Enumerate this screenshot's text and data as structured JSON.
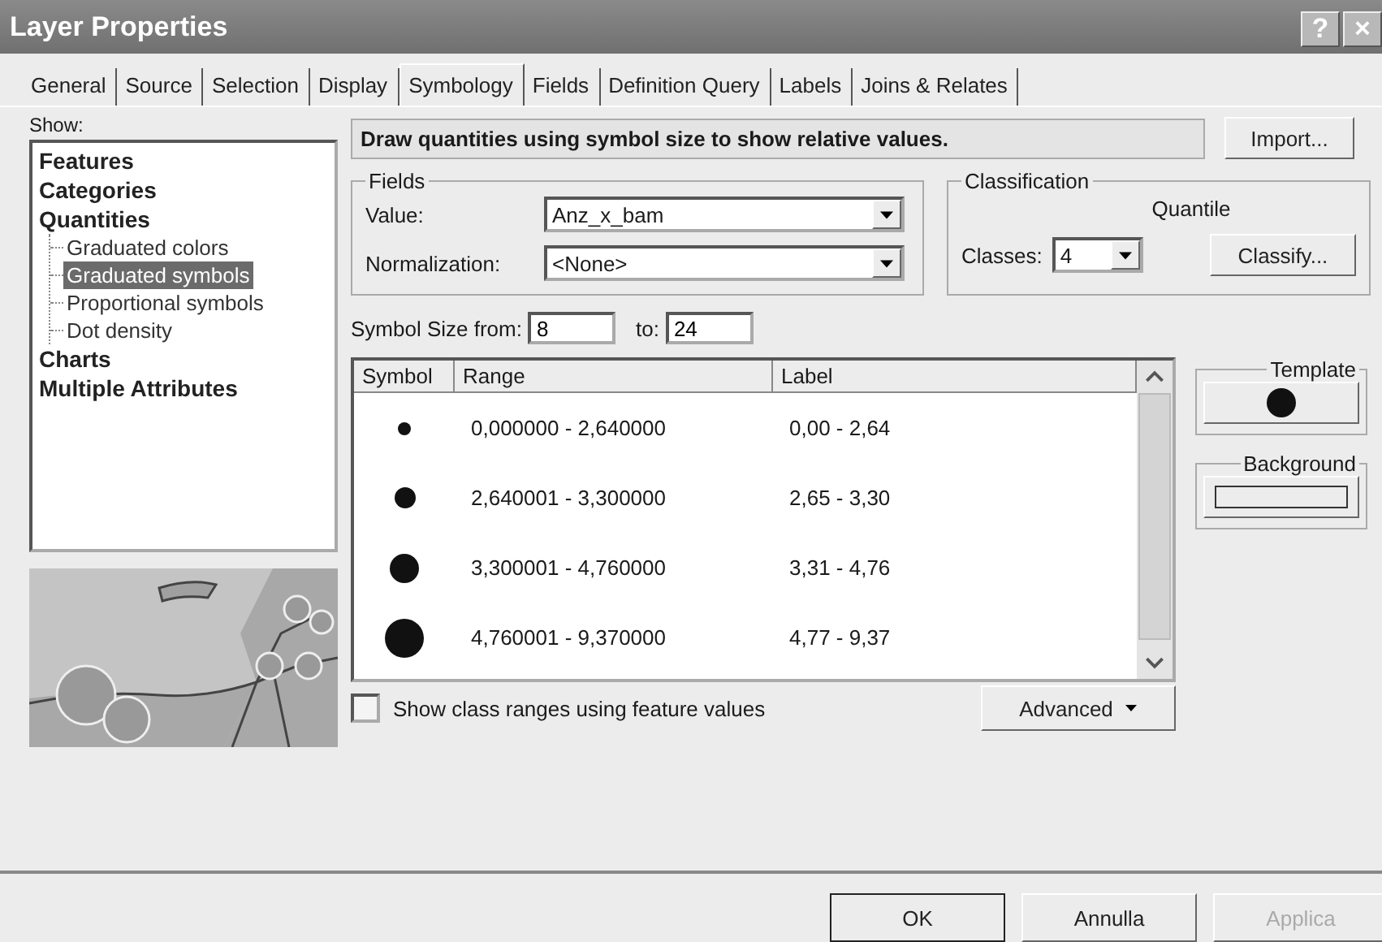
{
  "window": {
    "title": "Layer Properties",
    "help_glyph": "?",
    "close_glyph": "×"
  },
  "tabs": [
    {
      "label": "General",
      "selected": false
    },
    {
      "label": "Source",
      "selected": false
    },
    {
      "label": "Selection",
      "selected": false
    },
    {
      "label": "Display",
      "selected": false
    },
    {
      "label": "Symbology",
      "selected": true
    },
    {
      "label": "Fields",
      "selected": false
    },
    {
      "label": "Definition Query",
      "selected": false
    },
    {
      "label": "Labels",
      "selected": false
    },
    {
      "label": "Joins & Relates",
      "selected": false
    }
  ],
  "show": {
    "label": "Show:",
    "items": [
      {
        "label": "Features",
        "selected": false
      },
      {
        "label": "Categories",
        "selected": false
      },
      {
        "label": "Quantities",
        "selected": false,
        "children": [
          {
            "label": "Graduated colors",
            "selected": false
          },
          {
            "label": "Graduated symbols",
            "selected": true
          },
          {
            "label": "Proportional symbols",
            "selected": false
          },
          {
            "label": "Dot density",
            "selected": false
          }
        ]
      },
      {
        "label": "Charts",
        "selected": false
      },
      {
        "label": "Multiple Attributes",
        "selected": false
      }
    ]
  },
  "description": "Draw quantities using symbol size to show relative values.",
  "import_button": "Import...",
  "fields": {
    "title": "Fields",
    "value_label": "Value:",
    "value": "Anz_x_bam",
    "normalization_label": "Normalization:",
    "normalization": "<None>"
  },
  "classification": {
    "title": "Classification",
    "method": "Quantile",
    "classes_label": "Classes:",
    "classes": "4",
    "classify_button": "Classify..."
  },
  "symbol_size": {
    "from_label": "Symbol Size from:",
    "from": "8",
    "to_label": "to:",
    "to": "24"
  },
  "table": {
    "columns": [
      "Symbol",
      "Range",
      "Label"
    ],
    "rows": [
      {
        "range": "0,000000 - 2,640000",
        "label": "0,00 - 2,64"
      },
      {
        "range": "2,640001 - 3,300000",
        "label": "2,65 - 3,30"
      },
      {
        "range": "3,300001 - 4,760000",
        "label": "3,31 - 4,76"
      },
      {
        "range": "4,760001 - 9,370000",
        "label": "4,77 - 9,37"
      }
    ]
  },
  "template": {
    "title": "Template"
  },
  "background": {
    "title": "Background"
  },
  "show_class_ranges": {
    "label": "Show class ranges using feature values",
    "checked": false
  },
  "advanced_button": "Advanced",
  "buttons": [
    {
      "label": "OK",
      "disabled": false,
      "default": true
    },
    {
      "label": "Annulla",
      "disabled": false,
      "default": false
    },
    {
      "label": "Applica",
      "disabled": true,
      "default": false
    }
  ]
}
